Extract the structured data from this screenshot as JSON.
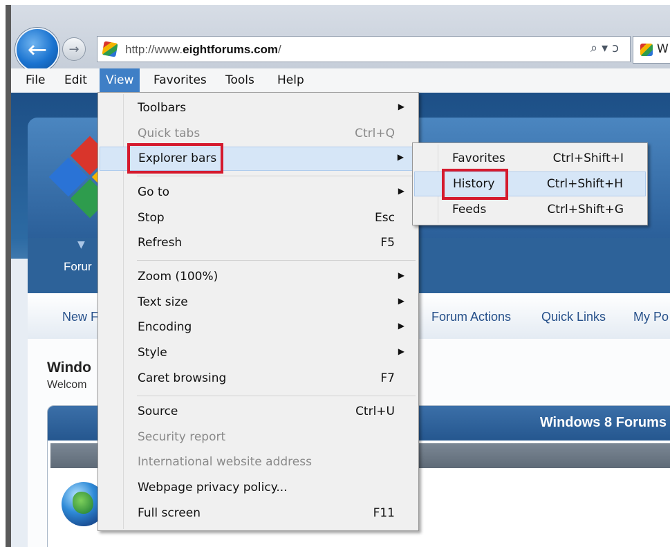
{
  "browser": {
    "back_glyph": "←",
    "forward_glyph": "→",
    "url_prefix": "http://www.",
    "url_domain": "eightforums.com",
    "url_suffix": "/",
    "addr_tools": "⌕▾ↄ",
    "tab_letter": "W",
    "icons": [
      "back-arrow-icon",
      "forward-arrow-icon",
      "site-favicon-icon",
      "search-icon",
      "refresh-icon"
    ]
  },
  "menubar": {
    "items": [
      "File",
      "Edit",
      "View",
      "Favorites",
      "Tools",
      "Help"
    ],
    "active": "View"
  },
  "page": {
    "forum_tab": "Forur",
    "nav_links": [
      "New F",
      "Forum Actions",
      "Quick Links",
      "My Po"
    ],
    "welcome_title": "Windo",
    "welcome_sub": "Welcom",
    "box_title": "Windows 8 Forums"
  },
  "view_menu": {
    "items": [
      {
        "label": "Toolbars",
        "shortcut": "",
        "arrow": "▶",
        "disabled": false
      },
      {
        "label": "Quick tabs",
        "shortcut": "Ctrl+Q",
        "arrow": "",
        "disabled": true
      },
      {
        "label": "Explorer bars",
        "shortcut": "",
        "arrow": "▶",
        "disabled": false,
        "highlighted": true
      },
      {
        "label": "Go to",
        "shortcut": "",
        "arrow": "▶",
        "disabled": false
      },
      {
        "label": "Stop",
        "shortcut": "Esc",
        "arrow": "",
        "disabled": false
      },
      {
        "label": "Refresh",
        "shortcut": "F5",
        "arrow": "",
        "disabled": false
      },
      {
        "label": "Zoom (100%)",
        "shortcut": "",
        "arrow": "▶",
        "disabled": false
      },
      {
        "label": "Text size",
        "shortcut": "",
        "arrow": "▶",
        "disabled": false
      },
      {
        "label": "Encoding",
        "shortcut": "",
        "arrow": "▶",
        "disabled": false
      },
      {
        "label": "Style",
        "shortcut": "",
        "arrow": "▶",
        "disabled": false
      },
      {
        "label": "Caret browsing",
        "shortcut": "F7",
        "arrow": "",
        "disabled": false
      },
      {
        "label": "Source",
        "shortcut": "Ctrl+U",
        "arrow": "",
        "disabled": false
      },
      {
        "label": "Security report",
        "shortcut": "",
        "arrow": "",
        "disabled": true
      },
      {
        "label": "International website address",
        "shortcut": "",
        "arrow": "",
        "disabled": true
      },
      {
        "label": "Webpage privacy policy...",
        "shortcut": "",
        "arrow": "",
        "disabled": false
      },
      {
        "label": "Full screen",
        "shortcut": "F11",
        "arrow": "",
        "disabled": false
      }
    ]
  },
  "explorer_submenu": {
    "items": [
      {
        "label": "Favorites",
        "shortcut": "Ctrl+Shift+I"
      },
      {
        "label": "History",
        "shortcut": "Ctrl+Shift+H",
        "highlighted": true
      },
      {
        "label": "Feeds",
        "shortcut": "Ctrl+Shift+G"
      }
    ]
  },
  "colors": {
    "menu_highlight": "#d6e6f7",
    "callout_red": "#d51a2e",
    "menubar_active": "#3f7fc6"
  }
}
